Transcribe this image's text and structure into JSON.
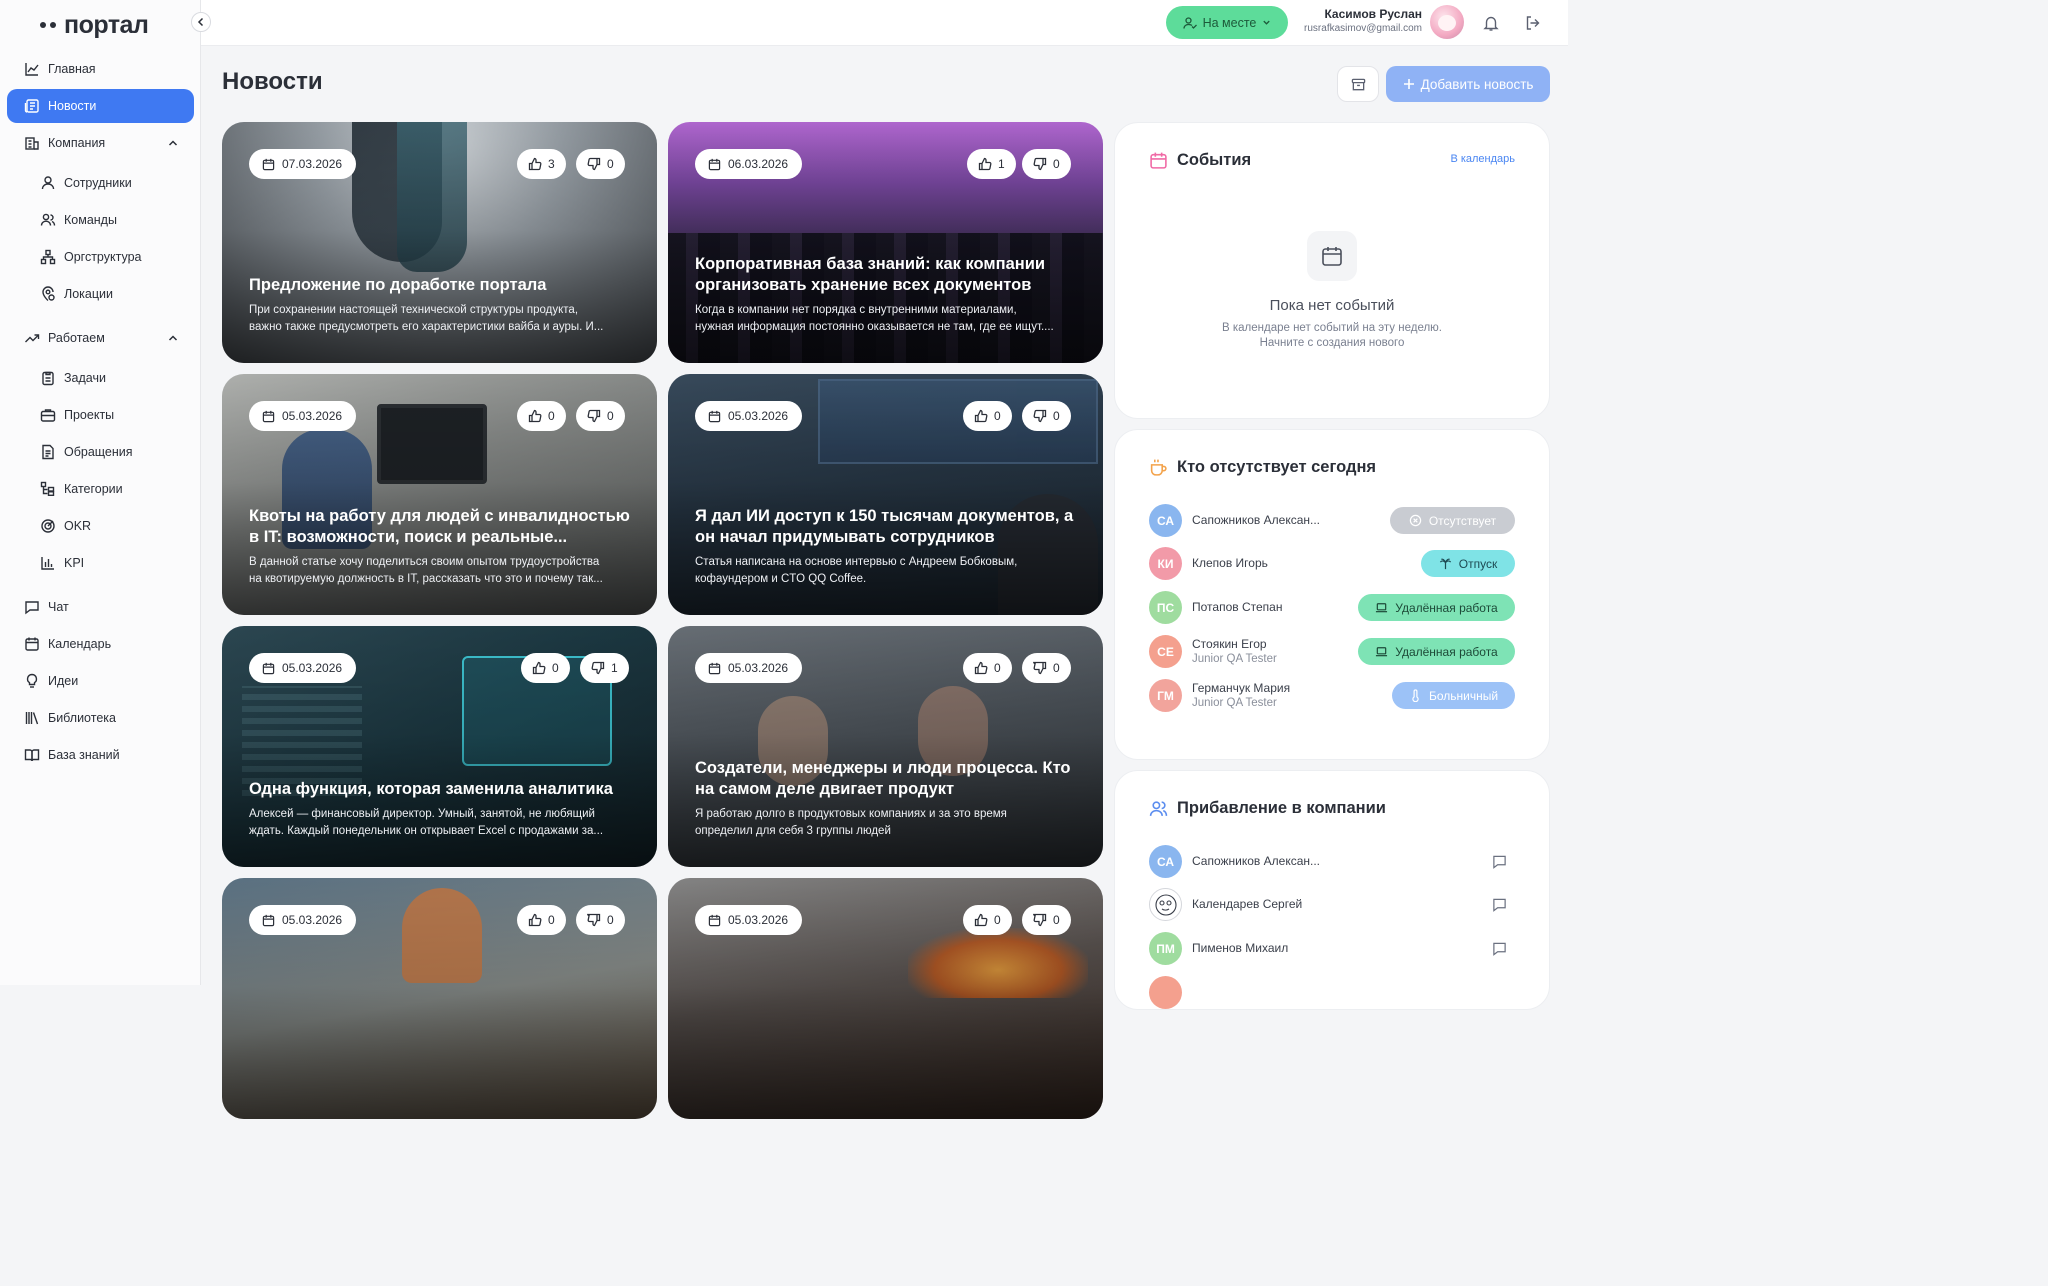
{
  "brand": {
    "logo_text": "портал"
  },
  "sidebar": {
    "items": [
      {
        "label": "Главная"
      },
      {
        "label": "Новости"
      },
      {
        "label": "Компания"
      },
      {
        "label": "Сотрудники"
      },
      {
        "label": "Команды"
      },
      {
        "label": "Оргструктура"
      },
      {
        "label": "Локации"
      },
      {
        "label": "Работаем"
      },
      {
        "label": "Задачи"
      },
      {
        "label": "Проекты"
      },
      {
        "label": "Обращения"
      },
      {
        "label": "Категории"
      },
      {
        "label": "OKR"
      },
      {
        "label": "KPI"
      },
      {
        "label": "Чат"
      },
      {
        "label": "Календарь"
      },
      {
        "label": "Идеи"
      },
      {
        "label": "Библиотека"
      },
      {
        "label": "База знаний"
      }
    ]
  },
  "header": {
    "status_label": "На месте",
    "user_name": "Касимов Руслан",
    "user_email": "rusrafkasimov@gmail.com"
  },
  "main": {
    "title": "Новости",
    "add_button_label": "Добавить новость",
    "news": [
      {
        "date": "07.03.2026",
        "likes": "3",
        "dislikes": "0",
        "title": "Предложение по доработке портала",
        "desc1": "При сохранении настоящей технической структуры продукта,",
        "desc2": "важно также предусмотреть его характеристики вайба и ауры. И..."
      },
      {
        "date": "06.03.2026",
        "likes": "1",
        "dislikes": "0",
        "title": "Корпоративная база знаний: как компании организовать хранение всех документов",
        "desc1": "Когда в компании нет порядка с внутренними материалами,",
        "desc2": "нужная информация постоянно оказывается не там, где ее ищут...."
      },
      {
        "date": "05.03.2026",
        "likes": "0",
        "dislikes": "0",
        "title": "Квоты на работу для людей с инвалидностью в IT: возможности, поиск и реальные...",
        "desc1": "В данной статье хочу поделиться своим опытом трудоустройства",
        "desc2": "на квотируемую должность в IT, рассказать что это и почему так..."
      },
      {
        "date": "05.03.2026",
        "likes": "0",
        "dislikes": "0",
        "title": "Я дал ИИ доступ к 150 тысячам документов, а он начал придумывать сотрудников",
        "desc1": "Статья написана на основе интервью с Андреем Бобковым,",
        "desc2": "кофаундером и CTO QQ Coffee."
      },
      {
        "date": "05.03.2026",
        "likes": "0",
        "dislikes": "1",
        "title": "Одна функция, которая заменила аналитика",
        "desc1": "Алексей — финансовый директор. Умный, занятой, не любящий",
        "desc2": "ждать. Каждый понедельник он открывает Excel с продажами за..."
      },
      {
        "date": "05.03.2026",
        "likes": "0",
        "dislikes": "0",
        "title": "Создатели, менеджеры и люди процесса. Кто на самом деле двигает продукт",
        "desc1": "Я работаю долго в продуктовых компаниях и за это время",
        "desc2": "определил для себя 3 группы людей"
      },
      {
        "date": "05.03.2026",
        "likes": "0",
        "dislikes": "0"
      },
      {
        "date": "05.03.2026",
        "likes": "0",
        "dislikes": "0"
      }
    ]
  },
  "events": {
    "title": "События",
    "link": "В календарь",
    "empty_title": "Пока нет событий",
    "empty_line1": "В календаре нет событий на эту неделю.",
    "empty_line2": "Начните с создания нового"
  },
  "absent": {
    "title": "Кто отсутствует сегодня",
    "people": [
      {
        "initials": "СА",
        "name": "Сапожников Алексан...",
        "role": "",
        "status": "Отсутствует",
        "color": "#8ab6ef"
      },
      {
        "initials": "КИ",
        "name": "Клепов Игорь",
        "role": "",
        "status": "Отпуск",
        "color": "#f29aa8"
      },
      {
        "initials": "ПС",
        "name": "Потапов Степан",
        "role": "",
        "status": "Удалённая работа",
        "color": "#9fdc9f"
      },
      {
        "initials": "СЕ",
        "name": "Стоякин Егор",
        "role": "Junior QA Tester",
        "status": "Удалённая работа",
        "color": "#f4a08e"
      },
      {
        "initials": "ГМ",
        "name": "Германчук Мария",
        "role": "Junior QA Tester",
        "status": "Больничный",
        "color": "#f2a49c"
      }
    ]
  },
  "newcomers": {
    "title": "Прибавление в компании",
    "people": [
      {
        "initials": "СА",
        "name": "Сапожников Алексан...",
        "color": "#8ab6ef"
      },
      {
        "initials": "",
        "name": "Календарев Сергей",
        "color": "#ffffff"
      },
      {
        "initials": "ПМ",
        "name": "Пименов Михаил",
        "color": "#9fdc9f"
      }
    ]
  },
  "colors": {
    "accent": "#3f79f2",
    "status_green": "#5ddc9a",
    "add_button": "#8fb2f5"
  }
}
